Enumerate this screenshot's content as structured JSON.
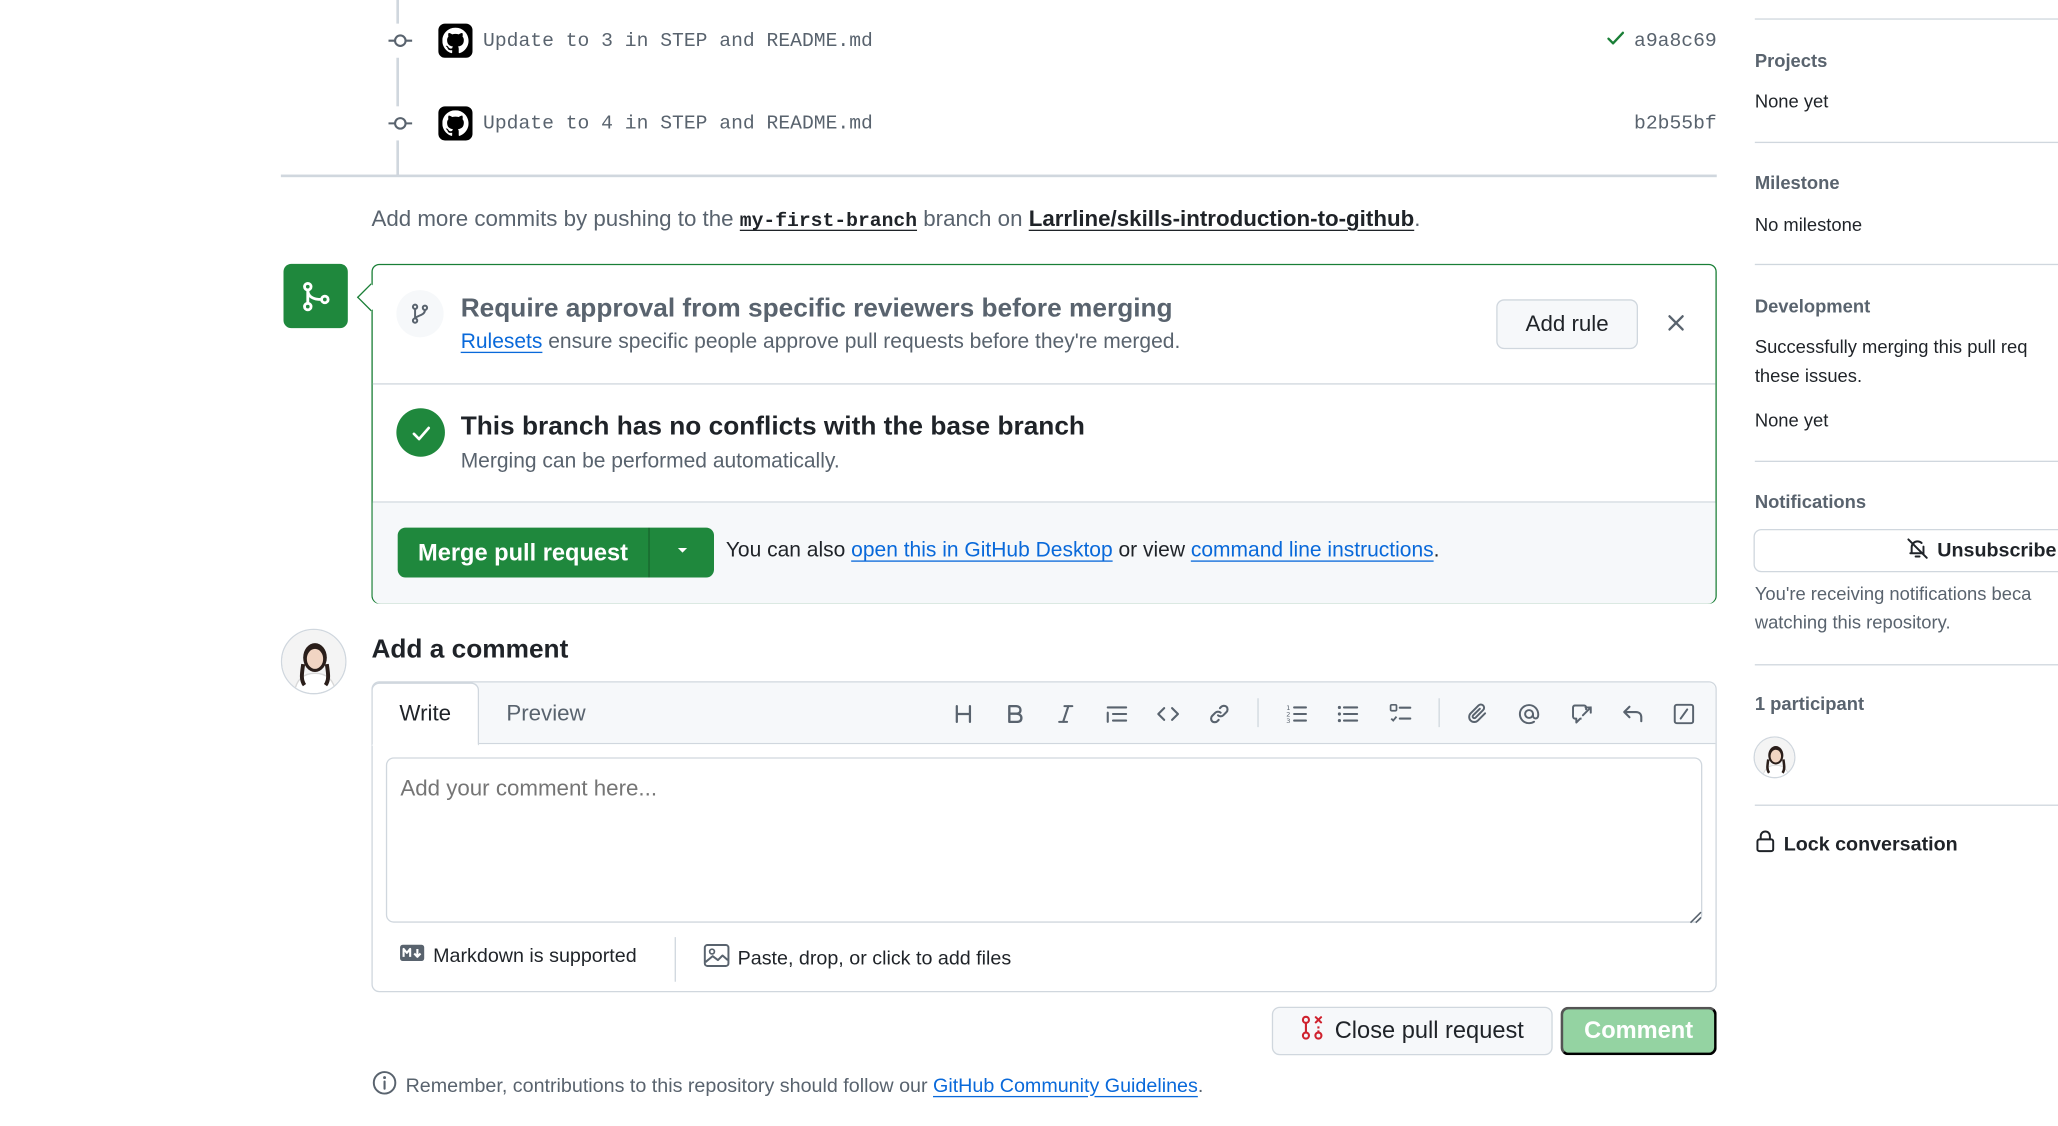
{
  "commits": [
    {
      "message": "Update to 3 in STEP and README.md",
      "sha": "a9a8c69",
      "checked": true
    },
    {
      "message": "Update to 4 in STEP and README.md",
      "sha": "b2b55bf",
      "checked": false
    }
  ],
  "push_hint": {
    "prefix": "Add more commits by pushing to the",
    "branch": "my-first-branch",
    "middle": "branch on",
    "repo": "Larrline/skills-introduction-to-github",
    "suffix": "."
  },
  "rules": {
    "title": "Require approval from specific reviewers before merging",
    "link": "Rulesets",
    "sub": "ensure specific people approve pull requests before they're merged.",
    "add_rule_label": "Add rule"
  },
  "conflicts": {
    "title": "This branch has no conflicts with the base branch",
    "sub": "Merging can be performed automatically."
  },
  "merge": {
    "button_label": "Merge pull request",
    "also_prefix": "You can also",
    "desktop_link": "open this in GitHub Desktop",
    "also_middle": "or view",
    "cli_link": "command line instructions",
    "also_suffix": "."
  },
  "comment": {
    "heading": "Add a comment",
    "tab_write": "Write",
    "tab_preview": "Preview",
    "placeholder": "Add your comment here...",
    "markdown_note": "Markdown is supported",
    "files_note": "Paste, drop, or click to add files",
    "close_pr_label": "Close pull request",
    "comment_label": "Comment",
    "guidelines_prefix": "Remember, contributions to this repository should follow our",
    "guidelines_link": "GitHub Community Guidelines",
    "guidelines_suffix": "."
  },
  "sidebar": {
    "projects_heading": "Projects",
    "projects_value": "None yet",
    "milestone_heading": "Milestone",
    "milestone_value": "No milestone",
    "development_heading": "Development",
    "development_line1": "Successfully merging this pull req",
    "development_line2": "these issues.",
    "development_value": "None yet",
    "notifications_heading": "Notifications",
    "unsubscribe_label": "Unsubscribe",
    "notifications_line1": "You're receiving notifications beca",
    "notifications_line2": "watching this repository.",
    "participants_heading": "1 participant",
    "lock_label": "Lock conversation"
  },
  "colors": {
    "accent_green": "#1f883d",
    "link_blue": "#0969da",
    "danger_red": "#cf222e",
    "disabled_green": "#94d3a2"
  }
}
